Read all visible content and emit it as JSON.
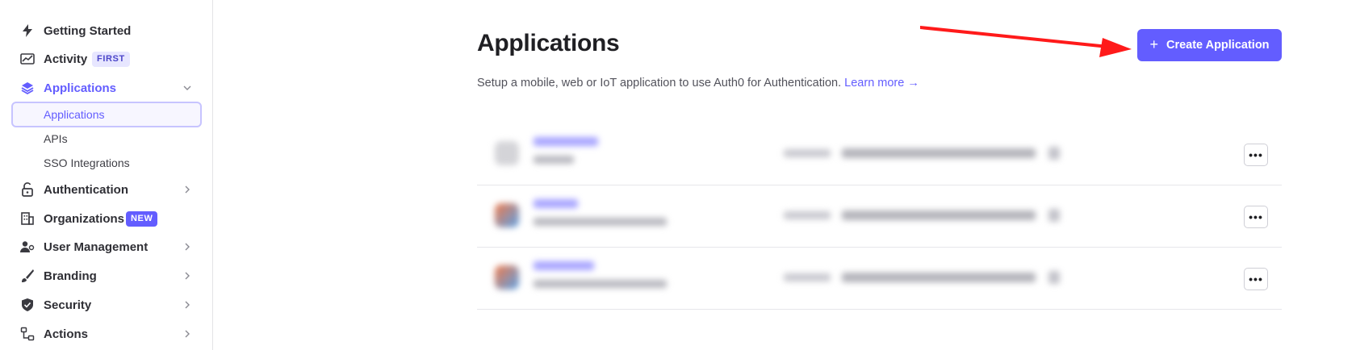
{
  "sidebar": {
    "items": [
      {
        "label": "Getting Started",
        "icon": "lightning-icon"
      },
      {
        "label": "Activity",
        "icon": "activity-chart-icon",
        "badge": "FIRST"
      },
      {
        "label": "Applications",
        "icon": "layers-icon",
        "expanded": true,
        "active": true,
        "children": [
          {
            "label": "Applications",
            "selected": true
          },
          {
            "label": "APIs"
          },
          {
            "label": "SSO Integrations"
          }
        ]
      },
      {
        "label": "Authentication",
        "icon": "lock-icon"
      },
      {
        "label": "Organizations",
        "icon": "building-icon",
        "badge": "NEW"
      },
      {
        "label": "User Management",
        "icon": "users-icon"
      },
      {
        "label": "Branding",
        "icon": "brush-icon"
      },
      {
        "label": "Security",
        "icon": "shield-icon"
      },
      {
        "label": "Actions",
        "icon": "flow-icon"
      }
    ]
  },
  "main": {
    "title": "Applications",
    "subtitle": "Setup a mobile, web or IoT application to use Auth0 for Authentication.",
    "learn_more": "Learn more →",
    "create_button": "Create Application",
    "create_icon": "plus-icon",
    "more_label": "•••"
  },
  "colors": {
    "accent": "#635dff",
    "annotation_arrow": "#ff1a1a"
  }
}
